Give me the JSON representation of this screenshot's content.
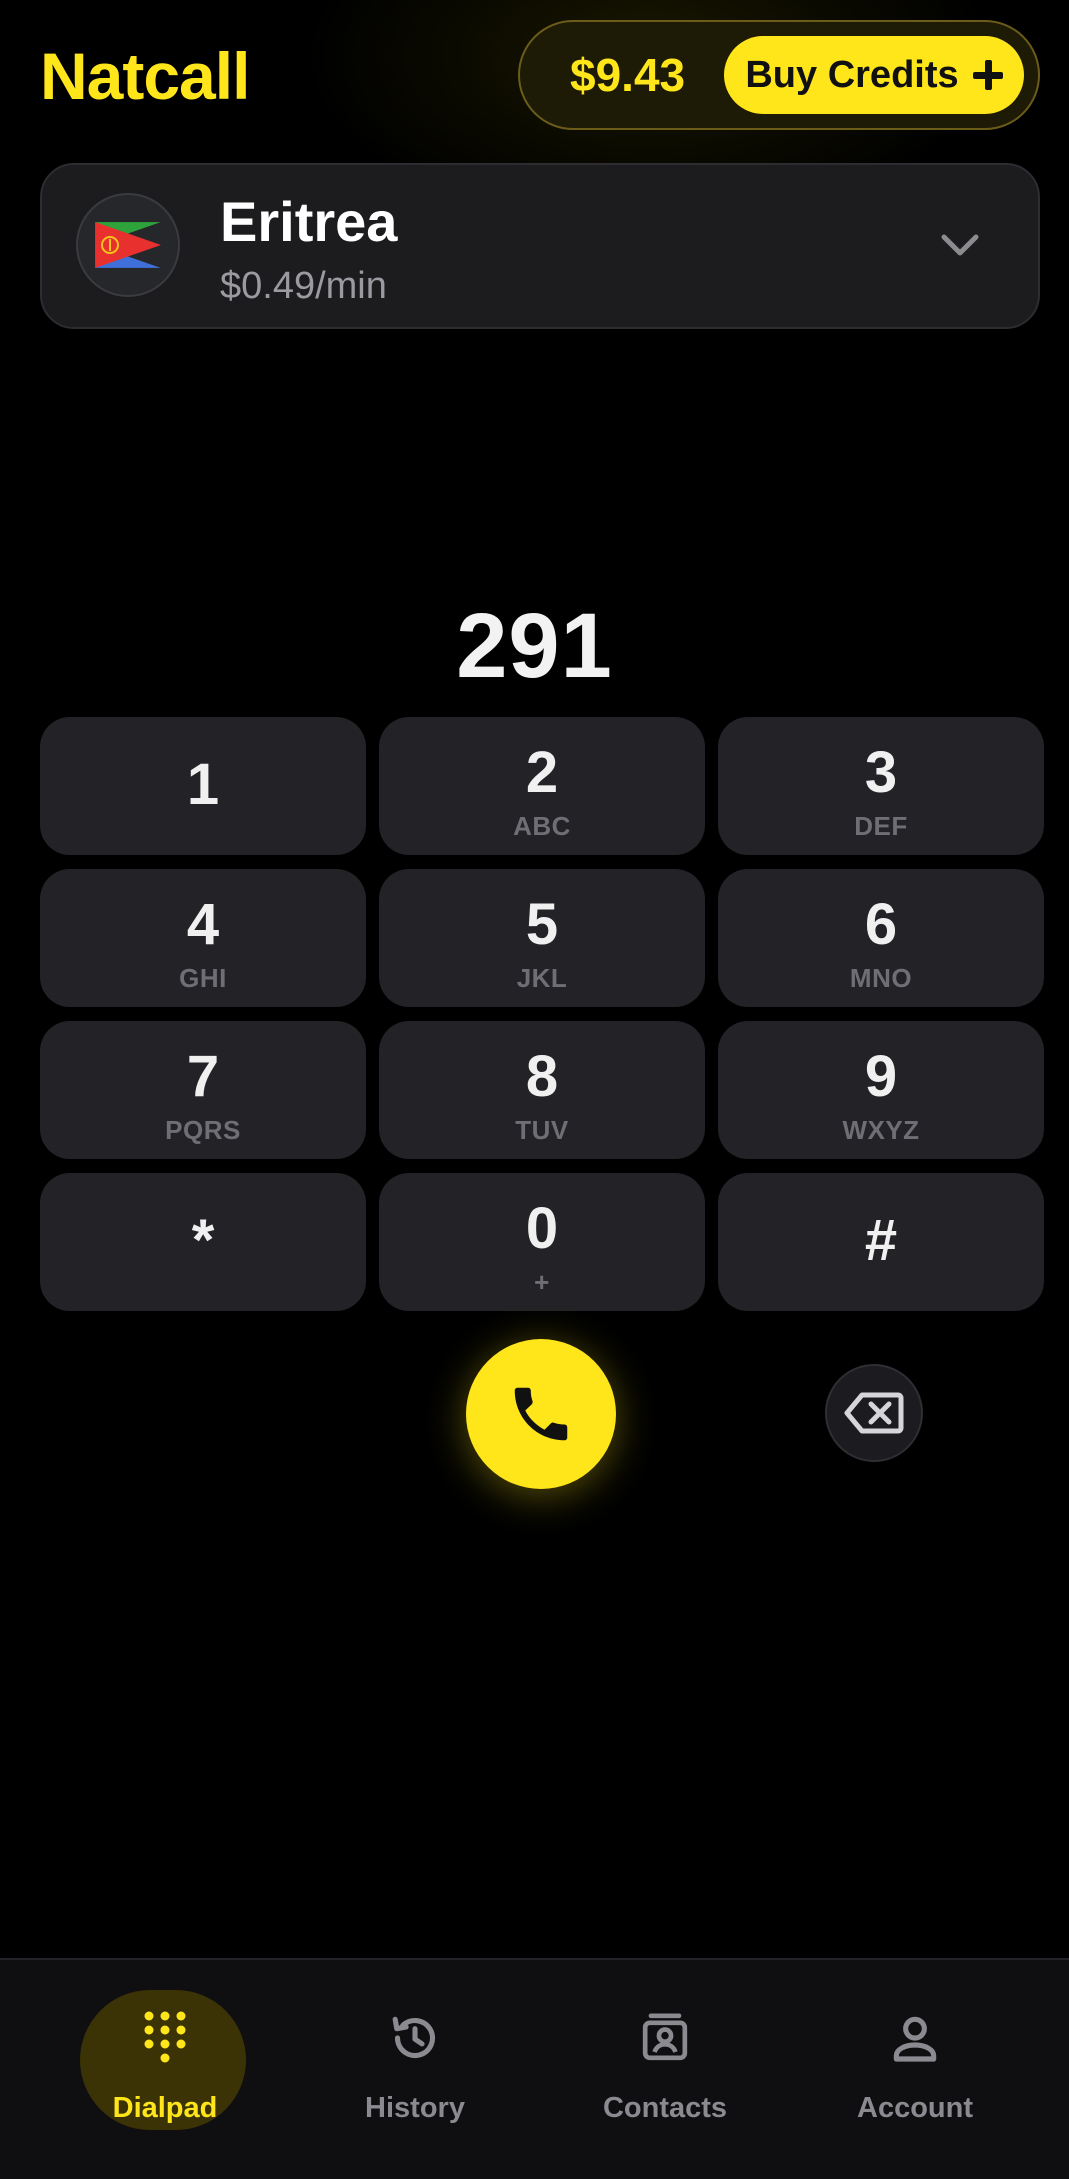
{
  "header": {
    "brand": "Natcall",
    "balance": "$9.43",
    "buy_credits_label": "Buy Credits",
    "accent_color": "#FFE61A"
  },
  "country_selector": {
    "name": "Eritrea",
    "rate": "$0.49/min",
    "flag_icon": "eritrea-flag-icon",
    "dropdown_icon": "chevron-down-icon"
  },
  "dialer": {
    "number": "291"
  },
  "keypad": [
    {
      "digit": "1",
      "letters": ""
    },
    {
      "digit": "2",
      "letters": "ABC"
    },
    {
      "digit": "3",
      "letters": "DEF"
    },
    {
      "digit": "4",
      "letters": "GHI"
    },
    {
      "digit": "5",
      "letters": "JKL"
    },
    {
      "digit": "6",
      "letters": "MNO"
    },
    {
      "digit": "7",
      "letters": "PQRS"
    },
    {
      "digit": "8",
      "letters": "TUV"
    },
    {
      "digit": "9",
      "letters": "WXYZ"
    },
    {
      "digit": "*",
      "letters": ""
    },
    {
      "digit": "0",
      "letters": "+"
    },
    {
      "digit": "#",
      "letters": ""
    }
  ],
  "actions": {
    "call_icon": "phone-icon",
    "delete_icon": "backspace-icon"
  },
  "nav": {
    "items": [
      {
        "label": "Dialpad",
        "icon": "dialpad-icon",
        "active": true
      },
      {
        "label": "History",
        "icon": "history-icon",
        "active": false
      },
      {
        "label": "Contacts",
        "icon": "contacts-icon",
        "active": false
      },
      {
        "label": "Account",
        "icon": "account-icon",
        "active": false
      }
    ]
  }
}
